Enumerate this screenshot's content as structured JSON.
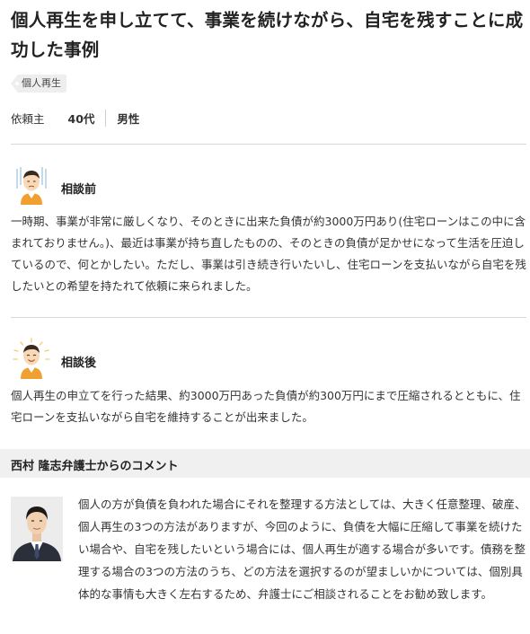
{
  "case": {
    "title": "個人再生を申し立てて、事業を続けながら、自宅を残すことに成功した事例",
    "tag": "個人再生",
    "client": {
      "label": "依頼主",
      "age": "40代",
      "gender": "男性"
    }
  },
  "before": {
    "heading": "相談前",
    "text": "一時期、事業が非常に厳しくなり、そのときに出来た負債が約3000万円あり(住宅ローンはこの中に含まれておりません。)、最近は事業が持ち直したものの、そのときの負債が足かせになって生活を圧迫しているので、何とかしたい。ただし、事業は引き続き行いたいし、住宅ローンを支払いながら自宅を残したいとの希望を持たれて依頼に来られました。"
  },
  "after": {
    "heading": "相談後",
    "text": "個人再生の申立てを行った結果、約3000万円あった負債が約300万円にまで圧縮されるとともに、住宅ローンを支払いながら自宅を維持することが出来ました。"
  },
  "comment": {
    "heading": "西村 隆志弁護士からのコメント",
    "text": "個人の方が負債を負われた場合にそれを整理する方法としては、大きく任意整理、破産、個人再生の3つの方法がありますが、今回のように、負債を大幅に圧縮して事業を続けたい場合や、自宅を残したいという場合には、個人再生が適する場合が多いです。債務を整理する場合の3つの方法のうち、どの方法を選択するのが望ましいかについては、個別具体的な事情も大きく左右するため、弁護士にご相談されることをお勧め致します。"
  },
  "icons": {
    "before_avatar": "worried-person-icon",
    "after_avatar": "happy-person-icon",
    "tag_icon": "tag-icon"
  },
  "colors": {
    "accent_orange": "#f0a030",
    "divider": "#d8d8d8",
    "comment_bar": "#f0f0f0"
  }
}
